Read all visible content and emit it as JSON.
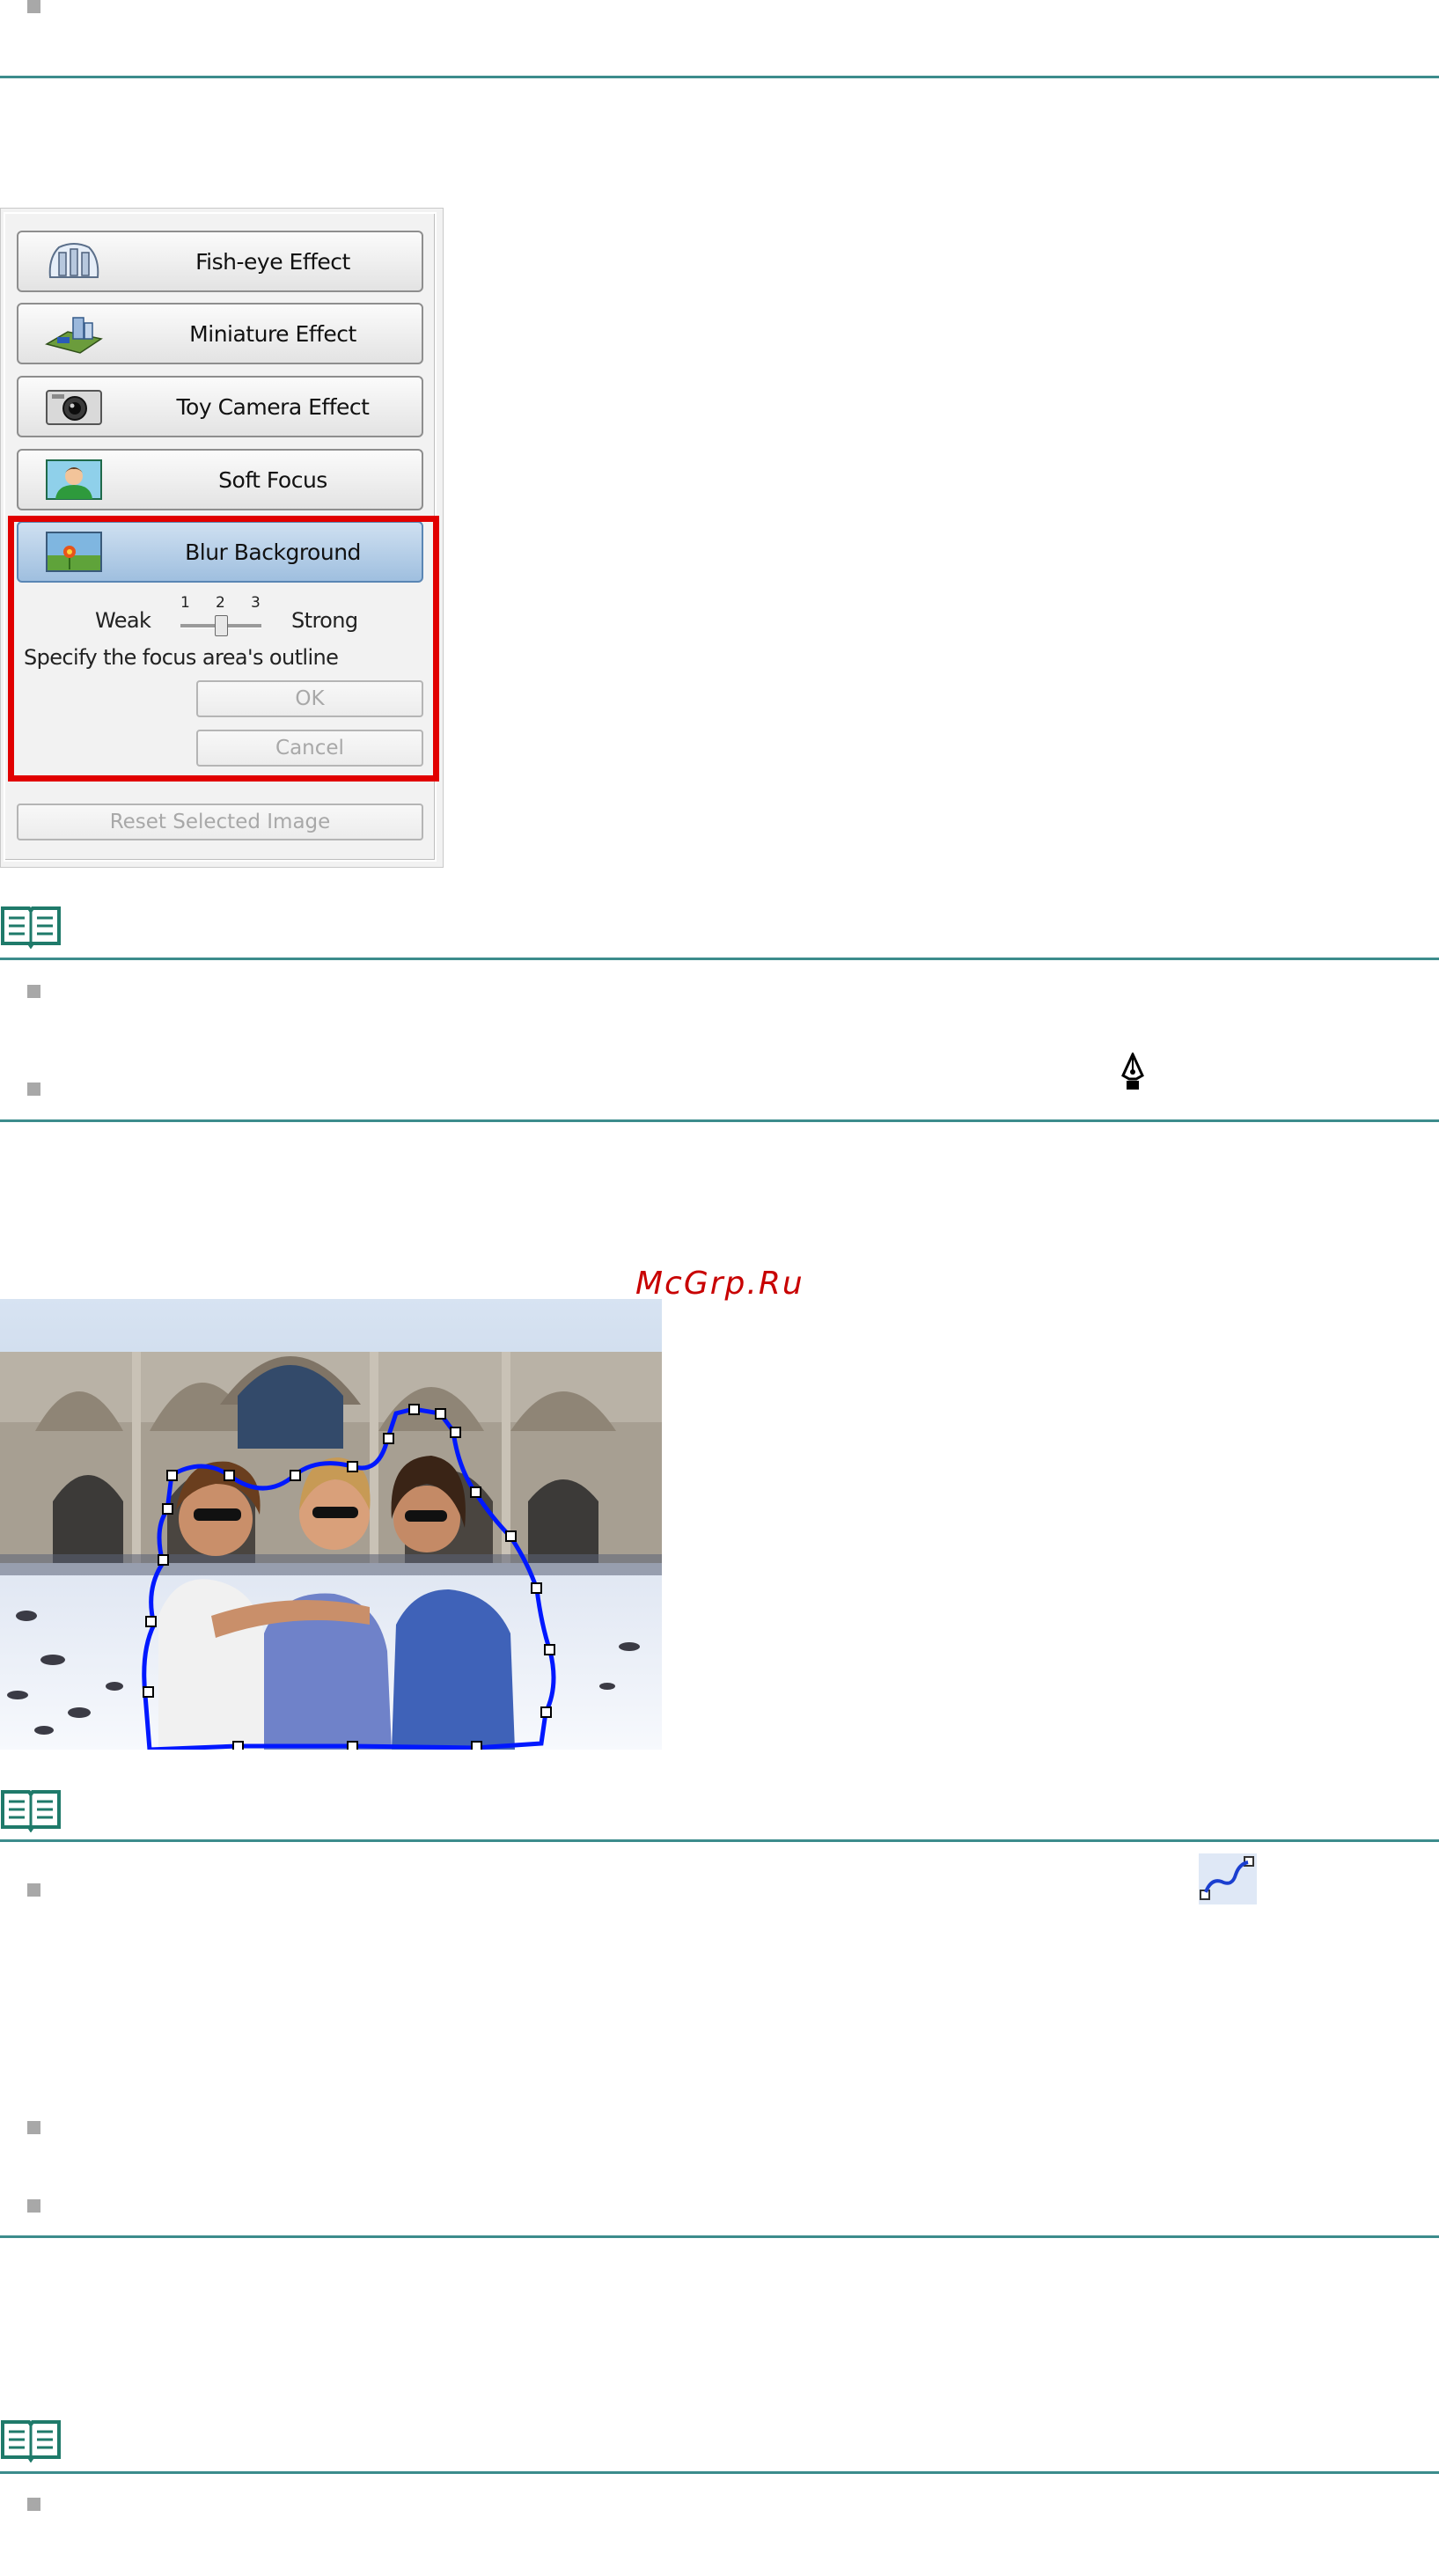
{
  "panel": {
    "effects": [
      {
        "label": "Fish-eye Effect",
        "icon": "fish-eye-icon"
      },
      {
        "label": "Miniature Effect",
        "icon": "miniature-icon"
      },
      {
        "label": "Toy Camera Effect",
        "icon": "camera-icon"
      },
      {
        "label": "Soft Focus",
        "icon": "portrait-icon"
      },
      {
        "label": "Blur Background",
        "icon": "flower-landscape-icon"
      }
    ],
    "selected_effect": "Blur Background",
    "slider": {
      "weak_label": "Weak",
      "strong_label": "Strong",
      "ticks": [
        "1",
        "2",
        "3"
      ],
      "value": 2
    },
    "instruction": "Specify the focus area's outline",
    "ok_label": "OK",
    "cancel_label": "Cancel",
    "reset_label": "Reset Selected Image"
  },
  "watermark": "McGrp.Ru",
  "icons": {
    "note": "note-book-icon",
    "pen": "pen-tool-icon",
    "curve": "curve-tool-icon"
  },
  "colors": {
    "rule": "#3c8c8c",
    "highlight": "#e10000",
    "selection_outline": "#0018ff"
  }
}
